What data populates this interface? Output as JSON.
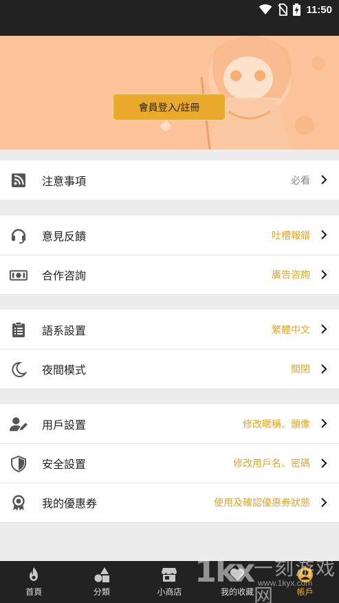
{
  "status_bar": {
    "time": "11:50",
    "icons": [
      "wifi-icon",
      "no-sim-icon",
      "battery-charging-icon"
    ]
  },
  "banner": {
    "login_button": "會員登入/註冊"
  },
  "groups": [
    {
      "rows": [
        {
          "label": "注意事項",
          "value": "必看",
          "value_style": "grey",
          "icon": "rss-icon"
        }
      ]
    },
    {
      "rows": [
        {
          "label": "意見反饋",
          "value": "吐槽報錯",
          "icon": "headset-icon"
        },
        {
          "label": "合作咨詢",
          "value": "廣告咨詢",
          "icon": "money-icon"
        }
      ]
    },
    {
      "rows": [
        {
          "label": "語系設置",
          "value": "繁體中文",
          "icon": "clipboard-icon"
        },
        {
          "label": "夜間模式",
          "value": "關閉",
          "icon": "moon-icon"
        }
      ]
    },
    {
      "rows": [
        {
          "label": "用戶設置",
          "value": "修改暱稱、頭像",
          "icon": "user-edit-icon"
        },
        {
          "label": "安全設置",
          "value": "修改用戶名、密碼",
          "icon": "shield-icon"
        },
        {
          "label": "我的優惠券",
          "value": "使用及確認優惠券狀態",
          "icon": "award-icon"
        }
      ]
    }
  ],
  "tabbar": {
    "tabs": [
      {
        "label": "首頁",
        "icon": "flame-icon"
      },
      {
        "label": "分類",
        "icon": "shapes-icon"
      },
      {
        "label": "小商店",
        "icon": "store-icon"
      },
      {
        "label": "我的收藏",
        "icon": "heart-icon"
      },
      {
        "label": "帳戶",
        "icon": "account-icon",
        "active": true
      }
    ]
  },
  "watermark": {
    "logo": "1kx",
    "text": "一刻游戏网",
    "url": "www.1kyx.com"
  },
  "colors": {
    "accent": "#e9a92a",
    "value_text": "#e5a523",
    "banner_bg": "#fcc39a",
    "bars": "#222222"
  }
}
